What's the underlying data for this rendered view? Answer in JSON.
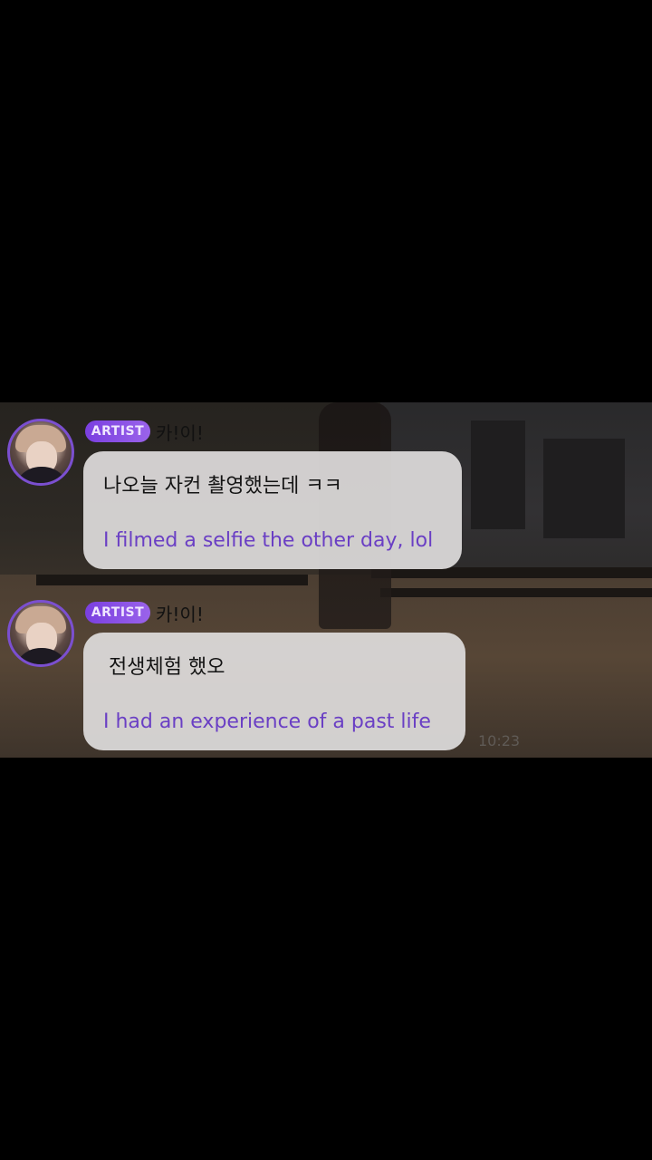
{
  "messages": [
    {
      "badge": "ARTIST",
      "name": "카!이!",
      "korean": "나오늘 자컨 촬영했는데 ㅋㅋ",
      "english": "I filmed a selfie the other day, lol"
    },
    {
      "badge": "ARTIST",
      "name": "카!이!",
      "korean": "전생체험 했오",
      "english": "I had an experience of a past life"
    }
  ],
  "timestamp": "10:23",
  "colors": {
    "badge": "#7a3fe0",
    "avatar_ring": "#7b4fd0",
    "translation_text": "#6a3fc4",
    "bubble": "#dedcdc",
    "background": "#000000"
  },
  "icons": {
    "avatar": "artist-profile-photo"
  }
}
